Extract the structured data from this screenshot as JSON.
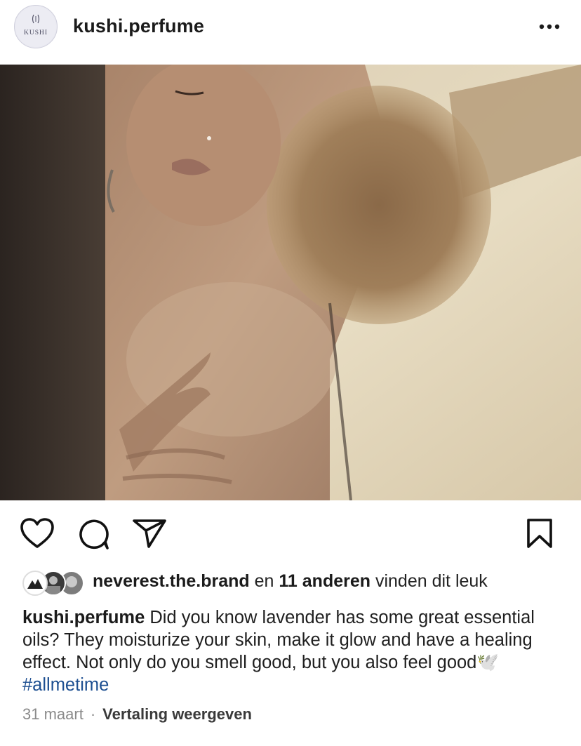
{
  "post": {
    "username": "kushi.perfume",
    "avatar_text": "KUSHI",
    "likes": {
      "first_liker": "neverest.the.brand",
      "connector": " en ",
      "others": "11 anderen",
      "suffix": " vinden dit leuk"
    },
    "caption": {
      "author": "kushi.perfume",
      "text": " Did you know lavender has some great essential oils? They moisturize your skin, make it glow and have a healing effect. Not only do you smell good, but you also feel good",
      "emoji": "🕊️",
      "hashtag": "#allmetime"
    },
    "date": "31 maart",
    "separator": "·",
    "translate_label": "Vertaling weergeven"
  },
  "icons": {
    "like": "heart-icon",
    "comment": "comment-icon",
    "share": "share-icon",
    "save": "bookmark-icon",
    "more": "more-options-icon"
  },
  "colors": {
    "hashtag": "#1d4f91",
    "meta_text": "#8a8a8a"
  }
}
